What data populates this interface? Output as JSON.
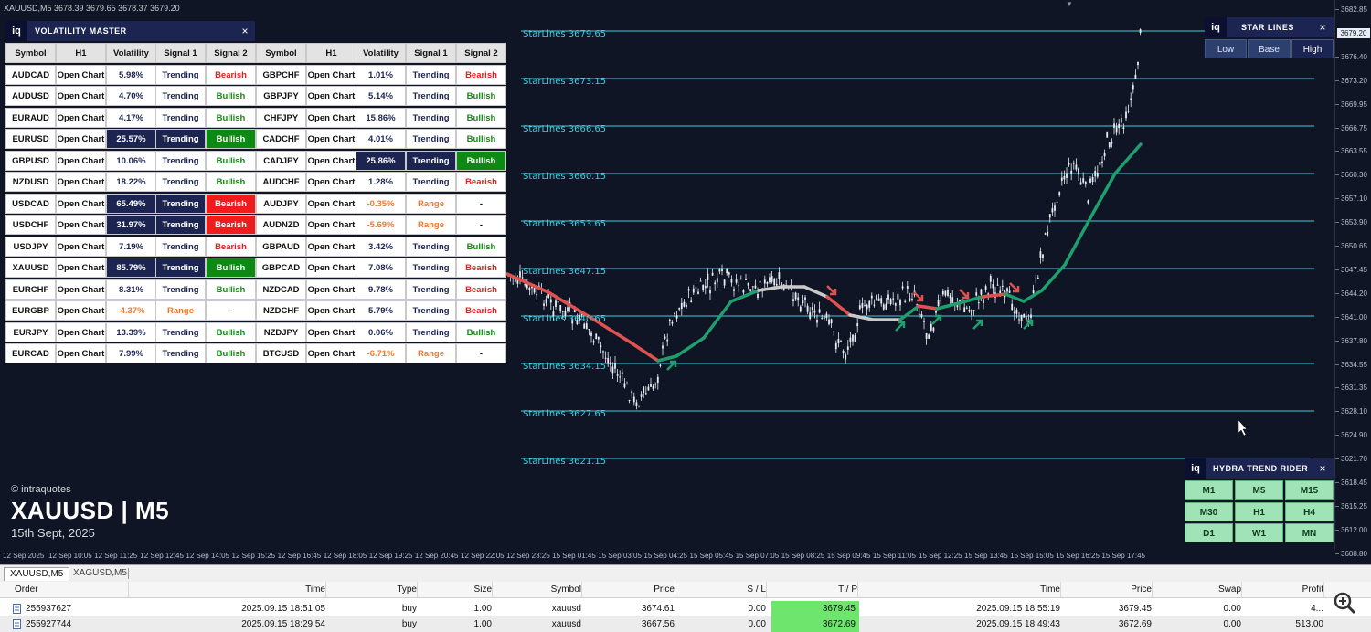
{
  "chart": {
    "info": "XAUUSD,M5  3678.39 3679.65 3678.37 3679.20",
    "current_price": "3679.20",
    "price_labels": [
      "3682.85",
      "3679.20",
      "3676.40",
      "3673.20",
      "3669.95",
      "3666.75",
      "3663.55",
      "3660.30",
      "3657.10",
      "3653.90",
      "3650.65",
      "3647.45",
      "3644.20",
      "3641.00",
      "3637.80",
      "3634.55",
      "3631.35",
      "3628.10",
      "3624.90",
      "3621.70",
      "3618.45",
      "3615.25",
      "3612.00",
      "3608.80"
    ],
    "time_labels": [
      "12 Sep 2025",
      "12 Sep 10:05",
      "12 Sep 11:25",
      "12 Sep 12:45",
      "12 Sep 14:05",
      "12 Sep 15:25",
      "12 Sep 16:45",
      "12 Sep 18:05",
      "12 Sep 19:25",
      "12 Sep 20:45",
      "12 Sep 22:05",
      "12 Sep 23:25",
      "15 Sep 01:45",
      "15 Sep 03:05",
      "15 Sep 04:25",
      "15 Sep 05:45",
      "15 Sep 07:05",
      "15 Sep 08:25",
      "15 Sep 09:45",
      "15 Sep 11:05",
      "15 Sep 12:25",
      "15 Sep 13:45",
      "15 Sep 15:05",
      "15 Sep 16:25",
      "15 Sep 17:45"
    ],
    "starlines": [
      "StarLines 3679.65",
      "StarLines 3673.15",
      "StarLines 3666.65",
      "StarLines 3660.15",
      "StarLines 3653.65",
      "StarLines 3647.15",
      "StarLines 3640.65",
      "StarLines 3634.15",
      "StarLines 3627.65",
      "StarLines 3621.15"
    ],
    "colors": {
      "starline": "#3cd0e0",
      "bull": "#1f9e6e",
      "bear": "#e0524f",
      "neutral": "#c9c9c9"
    }
  },
  "volatility_master": {
    "title": "VOLATILITY MASTER",
    "logo": "iq",
    "close": "×",
    "headers": [
      "Symbol",
      "H1",
      "Volatility",
      "Signal 1",
      "Signal 2",
      "Symbol",
      "H1",
      "Volatility",
      "Signal 1",
      "Signal 2"
    ],
    "rows": [
      [
        {
          "t": "AUDCAD"
        },
        {
          "t": "Open Chart"
        },
        {
          "t": "5.98%",
          "c": "#1c2552"
        },
        {
          "t": "Trending",
          "c": "#1c2552"
        },
        {
          "t": "Bearish",
          "c": "#e02020"
        },
        {
          "t": "GBPCHF"
        },
        {
          "t": "Open Chart"
        },
        {
          "t": "1.01%",
          "c": "#1c2552"
        },
        {
          "t": "Trending",
          "c": "#1c2552"
        },
        {
          "t": "Bearish",
          "c": "#e02020"
        }
      ],
      [
        {
          "t": "AUDUSD"
        },
        {
          "t": "Open Chart"
        },
        {
          "t": "4.70%",
          "c": "#1c2552"
        },
        {
          "t": "Trending",
          "c": "#1c2552"
        },
        {
          "t": "Bullish",
          "c": "#138a13"
        },
        {
          "t": "GBPJPY"
        },
        {
          "t": "Open Chart"
        },
        {
          "t": "5.14%",
          "c": "#1c2552"
        },
        {
          "t": "Trending",
          "c": "#1c2552"
        },
        {
          "t": "Bullish",
          "c": "#138a13"
        }
      ],
      [
        {
          "t": "EURAUD"
        },
        {
          "t": "Open Chart"
        },
        {
          "t": "4.17%",
          "c": "#1c2552"
        },
        {
          "t": "Trending",
          "c": "#1c2552"
        },
        {
          "t": "Bullish",
          "c": "#138a13"
        },
        {
          "t": "CHFJPY"
        },
        {
          "t": "Open Chart"
        },
        {
          "t": "15.86%",
          "c": "#1c2552"
        },
        {
          "t": "Trending",
          "c": "#1c2552"
        },
        {
          "t": "Bullish",
          "c": "#138a13"
        }
      ],
      [
        {
          "t": "EURUSD"
        },
        {
          "t": "Open Chart"
        },
        {
          "t": "25.57%",
          "c": "#ffffff",
          "bg": "#1c2552"
        },
        {
          "t": "Trending",
          "c": "#ffffff",
          "bg": "#1c2552"
        },
        {
          "t": "Bullish",
          "c": "#ffffff",
          "bg": "#0d8a13"
        },
        {
          "t": "CADCHF"
        },
        {
          "t": "Open Chart"
        },
        {
          "t": "4.01%",
          "c": "#1c2552"
        },
        {
          "t": "Trending",
          "c": "#1c2552"
        },
        {
          "t": "Bullish",
          "c": "#138a13"
        }
      ],
      [
        {
          "t": "GBPUSD"
        },
        {
          "t": "Open Chart"
        },
        {
          "t": "10.06%",
          "c": "#1c2552"
        },
        {
          "t": "Trending",
          "c": "#1c2552"
        },
        {
          "t": "Bullish",
          "c": "#138a13"
        },
        {
          "t": "CADJPY"
        },
        {
          "t": "Open Chart"
        },
        {
          "t": "25.86%",
          "c": "#ffffff",
          "bg": "#1c2552"
        },
        {
          "t": "Trending",
          "c": "#ffffff",
          "bg": "#1c2552"
        },
        {
          "t": "Bullish",
          "c": "#ffffff",
          "bg": "#0d8a13"
        }
      ],
      [
        {
          "t": "NZDUSD"
        },
        {
          "t": "Open Chart"
        },
        {
          "t": "18.22%",
          "c": "#1c2552"
        },
        {
          "t": "Trending",
          "c": "#1c2552"
        },
        {
          "t": "Bullish",
          "c": "#138a13"
        },
        {
          "t": "AUDCHF"
        },
        {
          "t": "Open Chart"
        },
        {
          "t": "1.28%",
          "c": "#1c2552"
        },
        {
          "t": "Trending",
          "c": "#1c2552"
        },
        {
          "t": "Bearish",
          "c": "#e02020"
        }
      ],
      [
        {
          "t": "USDCAD"
        },
        {
          "t": "Open Chart"
        },
        {
          "t": "65.49%",
          "c": "#ffffff",
          "bg": "#1c2552"
        },
        {
          "t": "Trending",
          "c": "#ffffff",
          "bg": "#1c2552"
        },
        {
          "t": "Bearish",
          "c": "#ffffff",
          "bg": "#ee1c1c"
        },
        {
          "t": "AUDJPY"
        },
        {
          "t": "Open Chart"
        },
        {
          "t": "-0.35%",
          "c": "#f07830"
        },
        {
          "t": "Range",
          "c": "#f07830"
        },
        {
          "t": "-"
        }
      ],
      [
        {
          "t": "USDCHF"
        },
        {
          "t": "Open Chart"
        },
        {
          "t": "31.97%",
          "c": "#ffffff",
          "bg": "#1c2552"
        },
        {
          "t": "Trending",
          "c": "#ffffff",
          "bg": "#1c2552"
        },
        {
          "t": "Bearish",
          "c": "#ffffff",
          "bg": "#ee1c1c"
        },
        {
          "t": "AUDNZD"
        },
        {
          "t": "Open Chart"
        },
        {
          "t": "-5.69%",
          "c": "#f07830"
        },
        {
          "t": "Range",
          "c": "#f07830"
        },
        {
          "t": "-"
        }
      ],
      [
        {
          "t": "USDJPY"
        },
        {
          "t": "Open Chart"
        },
        {
          "t": "7.19%",
          "c": "#1c2552"
        },
        {
          "t": "Trending",
          "c": "#1c2552"
        },
        {
          "t": "Bearish",
          "c": "#e02020"
        },
        {
          "t": "GBPAUD"
        },
        {
          "t": "Open Chart"
        },
        {
          "t": "3.42%",
          "c": "#1c2552"
        },
        {
          "t": "Trending",
          "c": "#1c2552"
        },
        {
          "t": "Bullish",
          "c": "#138a13"
        }
      ],
      [
        {
          "t": "XAUUSD"
        },
        {
          "t": "Open Chart"
        },
        {
          "t": "85.79%",
          "c": "#ffffff",
          "bg": "#1c2552"
        },
        {
          "t": "Trending",
          "c": "#ffffff",
          "bg": "#1c2552"
        },
        {
          "t": "Bullish",
          "c": "#ffffff",
          "bg": "#0d8a13"
        },
        {
          "t": "GBPCAD"
        },
        {
          "t": "Open Chart"
        },
        {
          "t": "7.08%",
          "c": "#1c2552"
        },
        {
          "t": "Trending",
          "c": "#1c2552"
        },
        {
          "t": "Bearish",
          "c": "#e02020"
        }
      ],
      [
        {
          "t": "EURCHF"
        },
        {
          "t": "Open Chart"
        },
        {
          "t": "8.31%",
          "c": "#1c2552"
        },
        {
          "t": "Trending",
          "c": "#1c2552"
        },
        {
          "t": "Bullish",
          "c": "#138a13"
        },
        {
          "t": "NZDCAD"
        },
        {
          "t": "Open Chart"
        },
        {
          "t": "9.78%",
          "c": "#1c2552"
        },
        {
          "t": "Trending",
          "c": "#1c2552"
        },
        {
          "t": "Bearish",
          "c": "#e02020"
        }
      ],
      [
        {
          "t": "EURGBP"
        },
        {
          "t": "Open Chart"
        },
        {
          "t": "-4.37%",
          "c": "#f07830"
        },
        {
          "t": "Range",
          "c": "#f07830"
        },
        {
          "t": "-"
        },
        {
          "t": "NZDCHF"
        },
        {
          "t": "Open Chart"
        },
        {
          "t": "5.79%",
          "c": "#1c2552"
        },
        {
          "t": "Trending",
          "c": "#1c2552"
        },
        {
          "t": "Bearish",
          "c": "#e02020"
        }
      ],
      [
        {
          "t": "EURJPY"
        },
        {
          "t": "Open Chart"
        },
        {
          "t": "13.39%",
          "c": "#1c2552"
        },
        {
          "t": "Trending",
          "c": "#1c2552"
        },
        {
          "t": "Bullish",
          "c": "#138a13"
        },
        {
          "t": "NZDJPY"
        },
        {
          "t": "Open Chart"
        },
        {
          "t": "0.06%",
          "c": "#1c2552"
        },
        {
          "t": "Trending",
          "c": "#1c2552"
        },
        {
          "t": "Bullish",
          "c": "#138a13"
        }
      ],
      [
        {
          "t": "EURCAD"
        },
        {
          "t": "Open Chart"
        },
        {
          "t": "7.99%",
          "c": "#1c2552"
        },
        {
          "t": "Trending",
          "c": "#1c2552"
        },
        {
          "t": "Bullish",
          "c": "#138a13"
        },
        {
          "t": "BTCUSD"
        },
        {
          "t": "Open Chart"
        },
        {
          "t": "-6.71%",
          "c": "#f07830"
        },
        {
          "t": "Range",
          "c": "#f07830"
        },
        {
          "t": "-"
        }
      ]
    ]
  },
  "star_lines_panel": {
    "logo": "iq",
    "title": "STAR LINES",
    "close": "×",
    "buttons": [
      "Low",
      "Base",
      "High"
    ],
    "active": "High"
  },
  "hydra_panel": {
    "logo": "iq",
    "title": "HYDRA TREND RIDER",
    "close": "×",
    "buttons": [
      "M1",
      "M5",
      "M15",
      "M30",
      "H1",
      "H4",
      "D1",
      "W1",
      "MN"
    ]
  },
  "branding": {
    "copyright": "© intraquotes",
    "symbol": "XAUUSD | M5",
    "date": "15th Sept, 2025"
  },
  "tabs": [
    "XAUUSD,M5",
    "XAGUSD,M5"
  ],
  "trade_table": {
    "headers": [
      "Order",
      "Time",
      "Type",
      "Size",
      "Symbol",
      "Price",
      "S / L",
      "T / P",
      "Time",
      "Price",
      "Swap",
      "Profit"
    ],
    "rows": [
      [
        "255937627",
        "2025.09.15 18:51:05",
        "buy",
        "1.00",
        "xauusd",
        "3674.61",
        "0.00",
        "3679.45",
        "2025.09.15 18:55:19",
        "3679.45",
        "0.00",
        "4..."
      ],
      [
        "255927744",
        "2025.09.15 18:29:54",
        "buy",
        "1.00",
        "xauusd",
        "3667.56",
        "0.00",
        "3672.69",
        "2025.09.15 18:49:43",
        "3672.69",
        "0.00",
        "513.00"
      ]
    ]
  }
}
